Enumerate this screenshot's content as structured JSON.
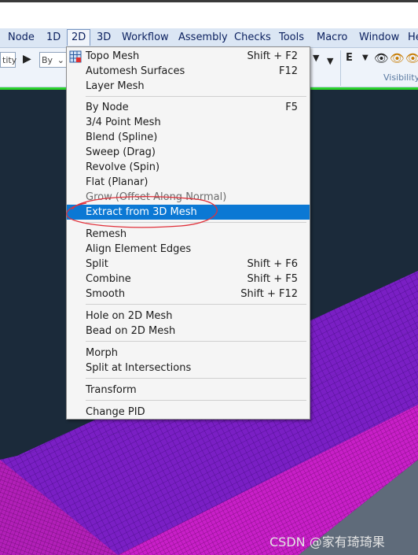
{
  "menubar": {
    "items": [
      "Node",
      "1D",
      "2D",
      "3D",
      "Workflow",
      "Assembly",
      "Checks",
      "Tools",
      "Macro",
      "Window",
      "He"
    ],
    "active": "2D"
  },
  "toolbar": {
    "entity_field": "tity",
    "by_field": "By",
    "visibility_label": "Visibility"
  },
  "menu": {
    "items": [
      {
        "label": "Topo Mesh",
        "shortcut": "Shift + F2"
      },
      {
        "label": "Automesh Surfaces",
        "shortcut": "F12"
      },
      {
        "label": "Layer Mesh",
        "shortcut": ""
      },
      {
        "label": "By Node",
        "shortcut": "F5"
      },
      {
        "label": "3/4 Point Mesh",
        "shortcut": ""
      },
      {
        "label": "Blend (Spline)",
        "shortcut": ""
      },
      {
        "label": "Sweep (Drag)",
        "shortcut": ""
      },
      {
        "label": "Revolve (Spin)",
        "shortcut": ""
      },
      {
        "label": "Flat (Planar)",
        "shortcut": ""
      },
      {
        "label": "Grow (Offset Along Normal)",
        "shortcut": ""
      },
      {
        "label": "Extract from 3D Mesh",
        "shortcut": ""
      },
      {
        "label": "Remesh",
        "shortcut": ""
      },
      {
        "label": "Align Element Edges",
        "shortcut": ""
      },
      {
        "label": "Split",
        "shortcut": "Shift + F6"
      },
      {
        "label": "Combine",
        "shortcut": "Shift + F5"
      },
      {
        "label": "Smooth",
        "shortcut": "Shift + F12"
      },
      {
        "label": "Hole on 2D Mesh",
        "shortcut": ""
      },
      {
        "label": "Bead on 2D Mesh",
        "shortcut": ""
      },
      {
        "label": "Morph",
        "shortcut": ""
      },
      {
        "label": "Split at Intersections",
        "shortcut": ""
      },
      {
        "label": "Transform",
        "shortcut": ""
      },
      {
        "label": "Change PID",
        "shortcut": ""
      }
    ],
    "highlighted_index": 10
  },
  "watermark": "CSDN @家有琦琦果",
  "colors": {
    "highlight": "#0b78d4",
    "mesh_purple": "#7a1fc4",
    "mesh_magenta": "#c81fc8",
    "annotation_red": "#e0303a",
    "status_green": "#29d32b"
  }
}
